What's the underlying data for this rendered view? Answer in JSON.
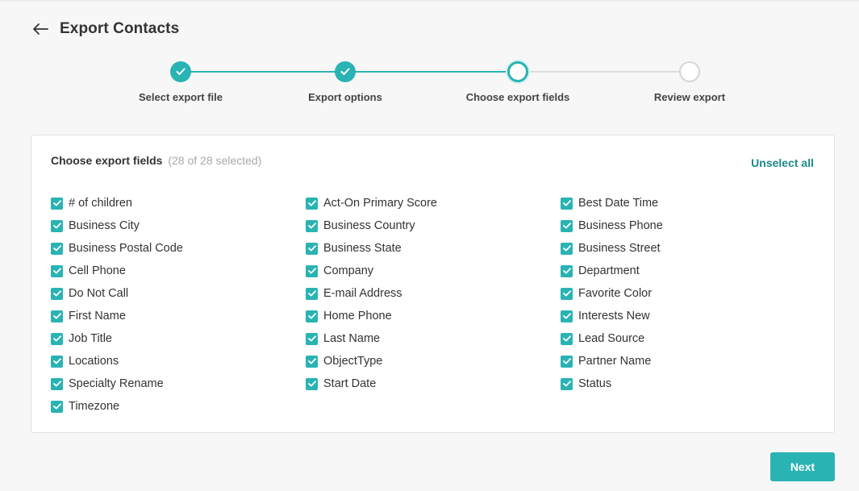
{
  "header": {
    "title": "Export Contacts",
    "back_icon": "arrow-left-icon"
  },
  "steps": [
    {
      "label": "Select export file",
      "state": "done"
    },
    {
      "label": "Export options",
      "state": "done"
    },
    {
      "label": "Choose export fields",
      "state": "current"
    },
    {
      "label": "Review export",
      "state": "todo"
    }
  ],
  "panel": {
    "title": "Choose export fields",
    "count": "(28 of 28 selected)",
    "unselect_label": "Unselect all"
  },
  "fields": {
    "col1": [
      "# of children",
      "Business City",
      "Business Postal Code",
      "Cell Phone",
      "Do Not Call",
      "First Name",
      "Job Title",
      "Locations",
      "Specialty Rename",
      "Timezone"
    ],
    "col2": [
      "Act-On Primary Score",
      "Business Country",
      "Business State",
      "Company",
      "E-mail Address",
      "Home Phone",
      "Last Name",
      "ObjectType",
      "Start Date"
    ],
    "col3": [
      "Best Date Time",
      "Business Phone",
      "Business Street",
      "Department",
      "Favorite Color",
      "Interests New",
      "Lead Source",
      "Partner Name",
      "Status"
    ],
    "checked": true
  },
  "footer": {
    "next_label": "Next"
  },
  "colors": {
    "accent": "#2ab3b3",
    "link": "#1e8a8a"
  }
}
